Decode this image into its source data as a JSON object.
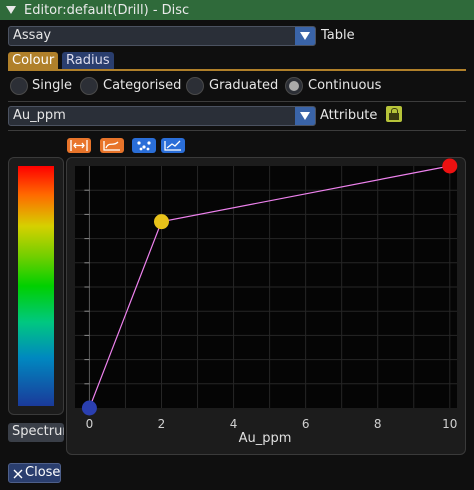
{
  "window": {
    "title": "Editor:default(Drill) - Disc"
  },
  "table_select": {
    "value": "Assay",
    "label": "Table"
  },
  "tabs": [
    {
      "label": "Colour",
      "active": true
    },
    {
      "label": "Radius",
      "active": false
    }
  ],
  "modes": [
    {
      "label": "Single",
      "selected": false
    },
    {
      "label": "Categorised",
      "selected": false
    },
    {
      "label": "Graduated",
      "selected": false
    },
    {
      "label": "Continuous",
      "selected": true
    }
  ],
  "attribute_select": {
    "value": "Au_ppm",
    "label": "Attribute"
  },
  "legend": {
    "label": "Spectrum"
  },
  "close_button": {
    "label": "Close"
  },
  "icons": [
    "horizontal-expand-icon",
    "curve-icon",
    "scatter-settings-icon",
    "trend-icon",
    "lock-icon",
    "close-icon"
  ],
  "colors": {
    "title_bar": "#2f6a3a",
    "tab_active": "#b0802a",
    "tab_inactive": "#2a3e6e",
    "curve": "#ee82ee"
  },
  "chart_data": {
    "type": "line",
    "xlabel": "Au_ppm",
    "x_ticks": [
      "0",
      "2",
      "4",
      "6",
      "8",
      "10"
    ],
    "xlim": [
      -0.4,
      10.2
    ],
    "ylim": [
      0,
      1
    ],
    "grid": true,
    "series": [
      {
        "x": [
          0,
          2,
          10
        ],
        "y": [
          0,
          0.77,
          1
        ],
        "point_colors": [
          "#2a3fb0",
          "#e8c21a",
          "#ee1111"
        ]
      }
    ]
  }
}
